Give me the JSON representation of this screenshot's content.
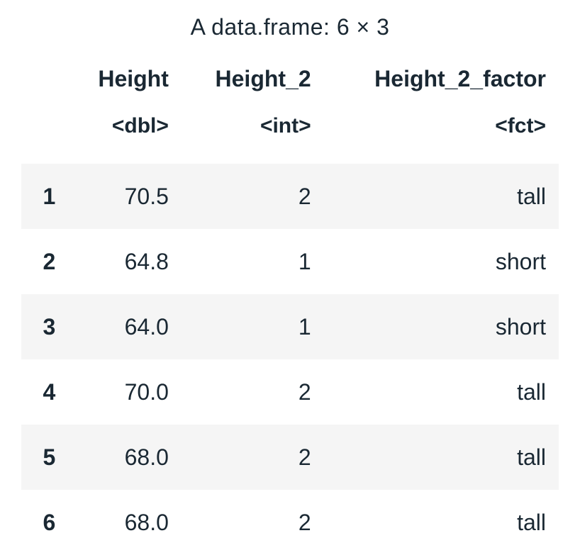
{
  "caption": "A data.frame: 6 × 3",
  "columns": [
    {
      "name": "Height",
      "type": "<dbl>"
    },
    {
      "name": "Height_2",
      "type": "<int>"
    },
    {
      "name": "Height_2_factor",
      "type": "<fct>"
    }
  ],
  "rows": [
    {
      "idx": "1",
      "Height": "70.5",
      "Height_2": "2",
      "Height_2_factor": "tall"
    },
    {
      "idx": "2",
      "Height": "64.8",
      "Height_2": "1",
      "Height_2_factor": "short"
    },
    {
      "idx": "3",
      "Height": "64.0",
      "Height_2": "1",
      "Height_2_factor": "short"
    },
    {
      "idx": "4",
      "Height": "70.0",
      "Height_2": "2",
      "Height_2_factor": "tall"
    },
    {
      "idx": "5",
      "Height": "68.0",
      "Height_2": "2",
      "Height_2_factor": "tall"
    },
    {
      "idx": "6",
      "Height": "68.0",
      "Height_2": "2",
      "Height_2_factor": "tall"
    }
  ]
}
